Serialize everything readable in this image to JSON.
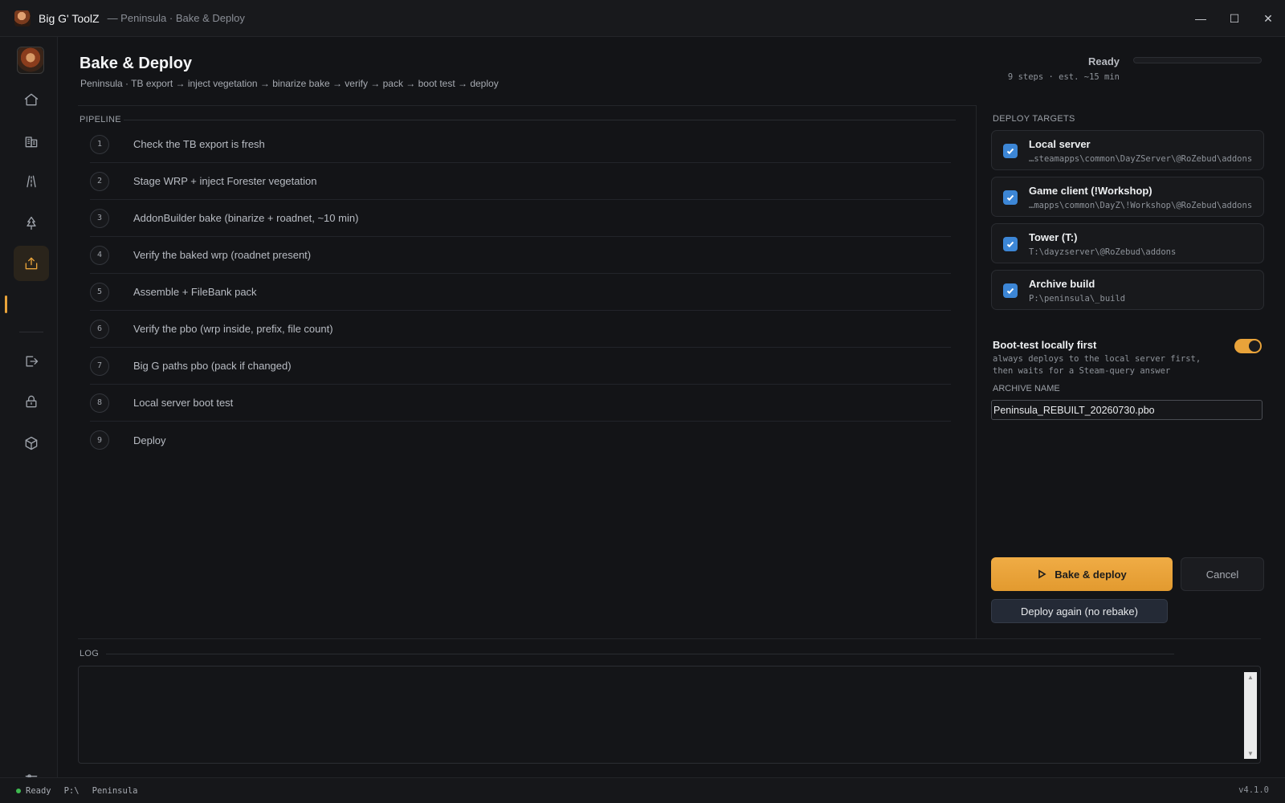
{
  "window": {
    "app_name": "Big G' ToolZ",
    "subtitle": "— Peninsula · Bake & Deploy",
    "controls": {
      "minimize": "—",
      "maximize": "☐",
      "close": "✕"
    }
  },
  "sidebar": {
    "items": [
      {
        "name": "home-icon"
      },
      {
        "name": "buildings-icon"
      },
      {
        "name": "road-icon"
      },
      {
        "name": "tree-icon"
      },
      {
        "name": "deploy-icon",
        "active": true
      },
      {
        "name": "export-icon"
      },
      {
        "name": "lock-icon"
      },
      {
        "name": "package-icon"
      }
    ],
    "settings_icon": "sliders-icon"
  },
  "header": {
    "title": "Bake & Deploy",
    "subtitle": "Peninsula · TB export → inject vegetation → binarize bake → verify → pack → boot test → deploy",
    "status": "Ready",
    "progress": 0,
    "meta": "9 steps · est. ~15 min"
  },
  "pipeline": {
    "label": "PIPELINE",
    "steps": [
      {
        "num": "1",
        "text": "Check the TB export is fresh"
      },
      {
        "num": "2",
        "text": "Stage WRP + inject Forester vegetation"
      },
      {
        "num": "3",
        "text": "AddonBuilder bake (binarize + roadnet, ~10 min)"
      },
      {
        "num": "4",
        "text": "Verify the baked wrp (roadnet present)"
      },
      {
        "num": "5",
        "text": "Assemble + FileBank pack"
      },
      {
        "num": "6",
        "text": "Verify the pbo (wrp inside, prefix, file count)"
      },
      {
        "num": "7",
        "text": "Big G paths pbo (pack if changed)"
      },
      {
        "num": "8",
        "text": "Local server boot test"
      },
      {
        "num": "9",
        "text": "Deploy"
      }
    ]
  },
  "targets": {
    "label": "DEPLOY TARGETS",
    "items": [
      {
        "name": "Local server",
        "path": "…steamapps\\common\\DayZServer\\@RoZebud\\addons",
        "checked": true
      },
      {
        "name": "Game client (!Workshop)",
        "path": "…mapps\\common\\DayZ\\!Workshop\\@RoZebud\\addons",
        "checked": true
      },
      {
        "name": "Tower (T:)",
        "path": "T:\\dayzserver\\@RoZebud\\addons",
        "checked": true
      },
      {
        "name": "Archive build",
        "path": "P:\\peninsula\\_build",
        "checked": true
      }
    ]
  },
  "boot_test": {
    "title": "Boot-test locally first",
    "desc_line1": "always deploys to the local server first,",
    "desc_line2": "then waits for a Steam-query answer",
    "enabled": true
  },
  "archive": {
    "label": "ARCHIVE NAME",
    "value": "Peninsula_REBUILT_20260730.pbo"
  },
  "actions": {
    "bake_deploy": "Bake & deploy",
    "cancel": "Cancel",
    "deploy_again": "Deploy again (no rebake)"
  },
  "log": {
    "label": "LOG"
  },
  "statusbar": {
    "status": "Ready",
    "drive": "P:\\",
    "project": "Peninsula",
    "version": "v4.1.0"
  },
  "colors": {
    "accent": "#e9a33a",
    "checkbox": "#3c86d6",
    "status_ok": "#3fb950"
  }
}
